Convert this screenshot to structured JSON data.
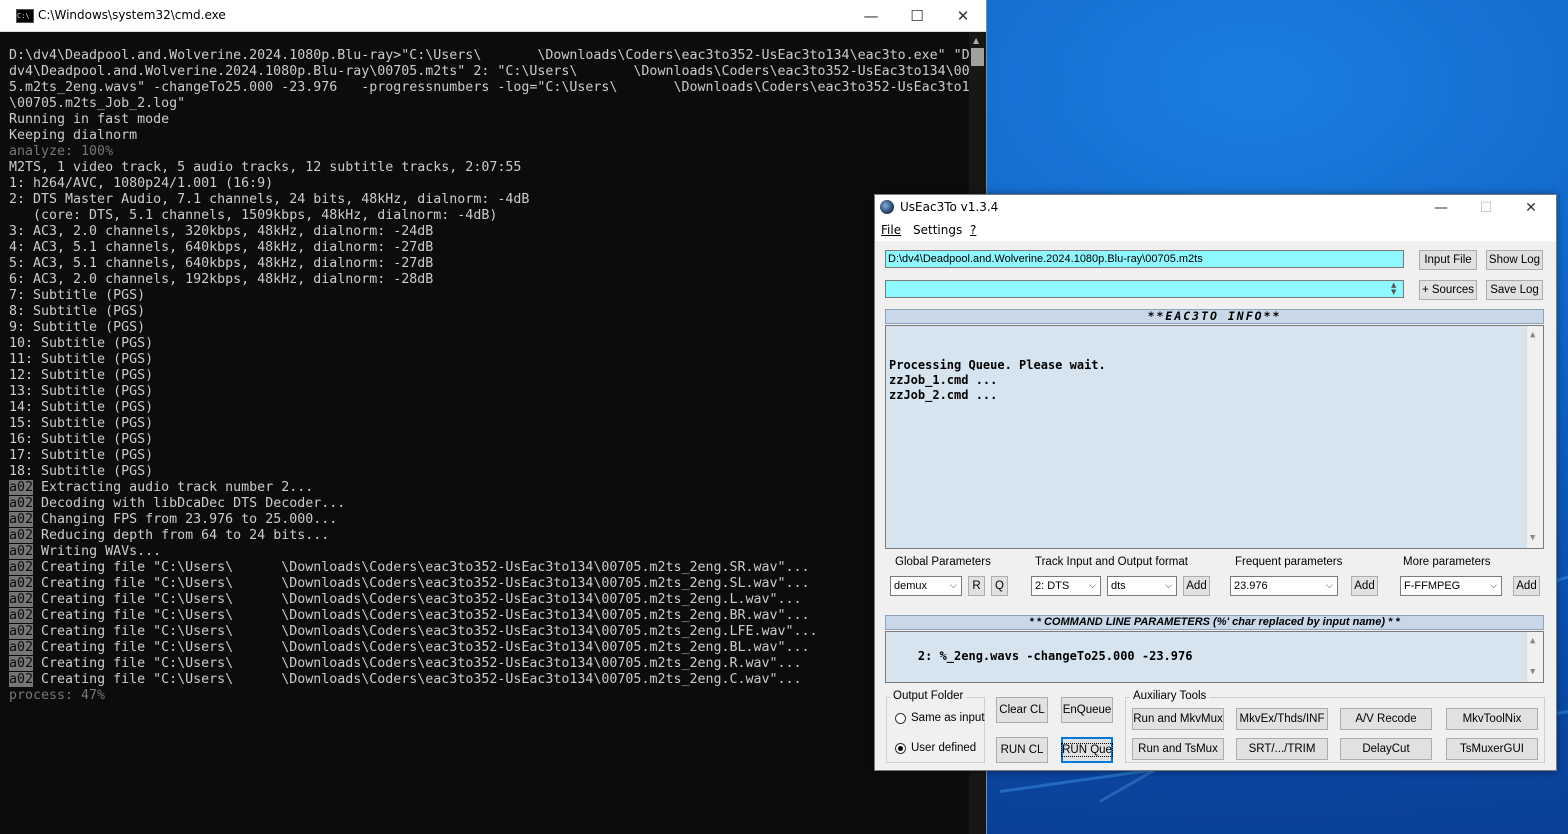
{
  "cmd": {
    "title": "C:\\Windows\\system32\\cmd.exe",
    "icon": "cmd-icon",
    "lines": [
      {
        "t": "D:\\dv4\\Deadpool.and.Wolverine.2024.1080p.Blu-ray>\"C:\\Users\\       \\Downloads\\Coders\\eac3to352-UsEac3to134\\eac3to.exe\" \"D:\\",
        "s": "n"
      },
      {
        "t": "dv4\\Deadpool.and.Wolverine.2024.1080p.Blu-ray\\00705.m2ts\" 2: \"C:\\Users\\       \\Downloads\\Coders\\eac3to352-UsEac3to134\\0070",
        "s": "n"
      },
      {
        "t": "5.m2ts_2eng.wavs\" -changeTo25.000 -23.976   -progressnumbers -log=\"C:\\Users\\       \\Downloads\\Coders\\eac3to352-UsEac3to134",
        "s": "n"
      },
      {
        "t": "\\00705.m2ts_Job_2.log\"",
        "s": "n"
      },
      {
        "t": "Running in fast mode",
        "s": "n"
      },
      {
        "t": "Keeping dialnorm",
        "s": "n"
      },
      {
        "t": "analyze: 100%",
        "s": "d"
      },
      {
        "t": "M2TS, 1 video track, 5 audio tracks, 12 subtitle tracks, 2:07:55",
        "s": "n"
      },
      {
        "t": "1: h264/AVC, 1080p24/1.001 (16:9)",
        "s": "n"
      },
      {
        "t": "2: DTS Master Audio, 7.1 channels, 24 bits, 48kHz, dialnorm: -4dB",
        "s": "n"
      },
      {
        "t": "   (core: DTS, 5.1 channels, 1509kbps, 48kHz, dialnorm: -4dB)",
        "s": "n"
      },
      {
        "t": "3: AC3, 2.0 channels, 320kbps, 48kHz, dialnorm: -24dB",
        "s": "n"
      },
      {
        "t": "4: AC3, 5.1 channels, 640kbps, 48kHz, dialnorm: -27dB",
        "s": "n"
      },
      {
        "t": "5: AC3, 5.1 channels, 640kbps, 48kHz, dialnorm: -27dB",
        "s": "n"
      },
      {
        "t": "6: AC3, 2.0 channels, 192kbps, 48kHz, dialnorm: -28dB",
        "s": "n"
      },
      {
        "t": "7: Subtitle (PGS)",
        "s": "n"
      },
      {
        "t": "8: Subtitle (PGS)",
        "s": "n"
      },
      {
        "t": "9: Subtitle (PGS)",
        "s": "n"
      },
      {
        "t": "10: Subtitle (PGS)",
        "s": "n"
      },
      {
        "t": "11: Subtitle (PGS)",
        "s": "n"
      },
      {
        "t": "12: Subtitle (PGS)",
        "s": "n"
      },
      {
        "t": "13: Subtitle (PGS)",
        "s": "n"
      },
      {
        "t": "14: Subtitle (PGS)",
        "s": "n"
      },
      {
        "t": "15: Subtitle (PGS)",
        "s": "n"
      },
      {
        "t": "16: Subtitle (PGS)",
        "s": "n"
      },
      {
        "t": "17: Subtitle (PGS)",
        "s": "n"
      },
      {
        "t": "18: Subtitle (PGS)",
        "s": "n"
      },
      {
        "p": "a02",
        "t": " Extracting audio track number 2...",
        "s": "n"
      },
      {
        "p": "a02",
        "t": " Decoding with libDcaDec DTS Decoder...",
        "s": "n"
      },
      {
        "p": "a02",
        "t": " Changing FPS from 23.976 to 25.000...",
        "s": "n"
      },
      {
        "p": "a02",
        "t": " Reducing depth from 64 to 24 bits...",
        "s": "n"
      },
      {
        "p": "a02",
        "t": " Writing WAVs...",
        "s": "n"
      },
      {
        "p": "a02",
        "t": " Creating file \"C:\\Users\\      \\Downloads\\Coders\\eac3to352-UsEac3to134\\00705.m2ts_2eng.SR.wav\"...",
        "s": "n"
      },
      {
        "p": "a02",
        "t": " Creating file \"C:\\Users\\      \\Downloads\\Coders\\eac3to352-UsEac3to134\\00705.m2ts_2eng.SL.wav\"...",
        "s": "n"
      },
      {
        "p": "a02",
        "t": " Creating file \"C:\\Users\\      \\Downloads\\Coders\\eac3to352-UsEac3to134\\00705.m2ts_2eng.L.wav\"...",
        "s": "n"
      },
      {
        "p": "a02",
        "t": " Creating file \"C:\\Users\\      \\Downloads\\Coders\\eac3to352-UsEac3to134\\00705.m2ts_2eng.BR.wav\"...",
        "s": "n"
      },
      {
        "p": "a02",
        "t": " Creating file \"C:\\Users\\      \\Downloads\\Coders\\eac3to352-UsEac3to134\\00705.m2ts_2eng.LFE.wav\"...",
        "s": "n"
      },
      {
        "p": "a02",
        "t": " Creating file \"C:\\Users\\      \\Downloads\\Coders\\eac3to352-UsEac3to134\\00705.m2ts_2eng.BL.wav\"...",
        "s": "n"
      },
      {
        "p": "a02",
        "t": " Creating file \"C:\\Users\\      \\Downloads\\Coders\\eac3to352-UsEac3to134\\00705.m2ts_2eng.R.wav\"...",
        "s": "n"
      },
      {
        "p": "a02",
        "t": " Creating file \"C:\\Users\\      \\Downloads\\Coders\\eac3to352-UsEac3to134\\00705.m2ts_2eng.C.wav\"...",
        "s": "n"
      },
      {
        "t": "process: 47%",
        "s": "d"
      }
    ],
    "colors": {
      "bg": "#0c0c0c",
      "fg": "#cccccc",
      "dim": "#767676"
    }
  },
  "ue": {
    "title": "UsEac3To v1.3.4",
    "menu": {
      "file": "File",
      "settings": "Settings",
      "help": "?"
    },
    "input_path": "D:\\dv4\\Deadpool.and.Wolverine.2024.1080p.Blu-ray\\00705.m2ts",
    "sources_value": "",
    "buttons": {
      "input_file": "Input File",
      "show_log": "Show Log",
      "sources": "+ Sources",
      "save_log": "Save Log",
      "r": "R",
      "q": "Q",
      "add": "Add",
      "clear_cl": "Clear CL",
      "enqueue": "EnQueue",
      "run_cl": "RUN CL",
      "run_que": "RUN Que",
      "run_mkvmux": "Run and MkvMux",
      "mkvex": "MkvEx/Thds/INF",
      "av_recode": "A/V Recode",
      "mkvtoolnix": "MkvToolNix",
      "run_tsmux": "Run and TsMux",
      "srt_trim": "SRT/.../TRIM",
      "delaycut": "DelayCut",
      "tsmuxergui": "TsMuxerGUI"
    },
    "info_header": "**EAC3TO INFO**",
    "info_lines": [
      "Processing Queue. Please wait.",
      "zzJob_1.cmd ...",
      "zzJob_2.cmd ..."
    ],
    "groups": {
      "global": "Global Parameters",
      "track": "Track Input and Output format",
      "frequent": "Frequent parameters",
      "more": "More parameters",
      "output_folder": "Output Folder",
      "aux": "Auxiliary Tools"
    },
    "selects": {
      "global": "demux",
      "track_in": "2: DTS",
      "track_out": "dts",
      "frequent": "23.976",
      "more": "F-FFMPEG"
    },
    "cl_header": "* * COMMAND LINE PARAMETERS (%' char replaced by input name) * *",
    "cl_text": "2: %_2eng.wavs -changeTo25.000 -23.976",
    "radios": {
      "same_as_input": "Same as input",
      "user_defined": "User defined",
      "selected": "user_defined"
    },
    "colors": {
      "field_bg": "#8ff8ff",
      "info_bg": "#d6e4f0",
      "header_bg": "#c8d8e8"
    }
  }
}
